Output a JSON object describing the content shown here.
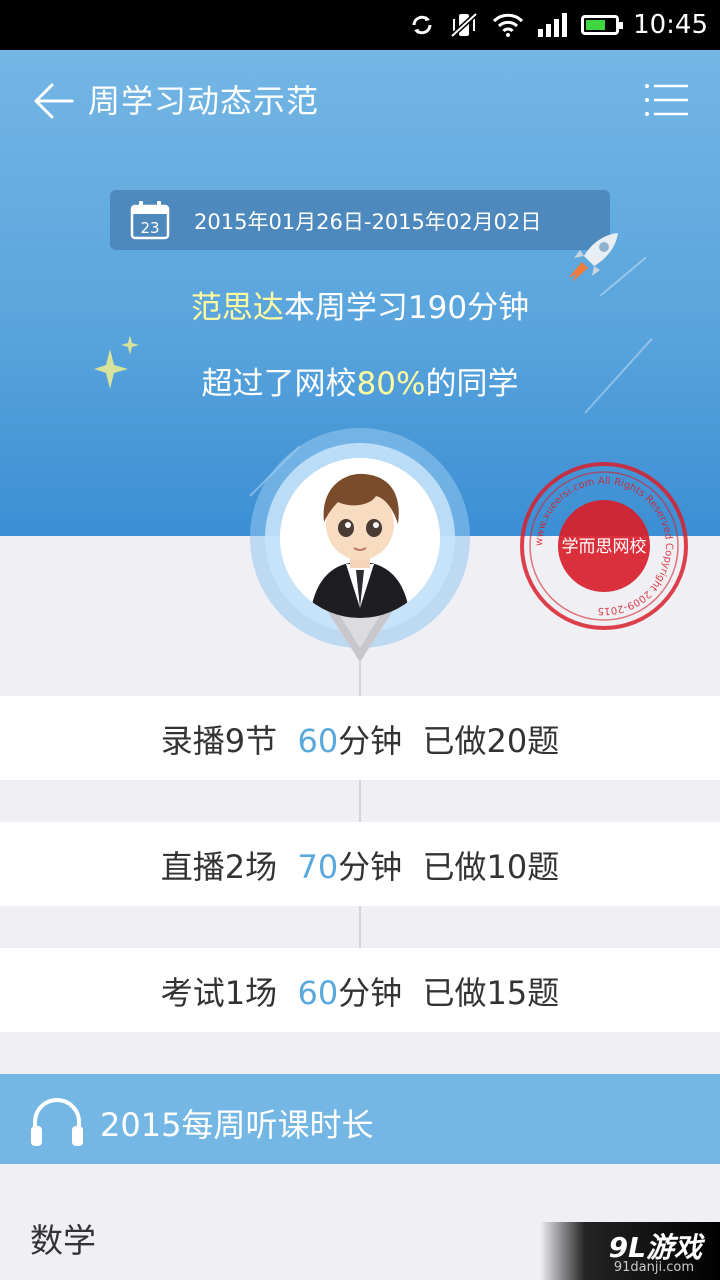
{
  "status_bar": {
    "time": "10:45"
  },
  "nav": {
    "title": "周学习动态示范"
  },
  "date_range": {
    "calendar_day": "23",
    "text": "2015年01月26日-2015年02月02日"
  },
  "summary": {
    "name": "范思达",
    "line1_rest": "本周学习190分钟",
    "line2_prefix": "超过了网校",
    "percent": "80%",
    "line2_suffix": "的同学"
  },
  "stamp": {
    "center_text": "学而思网校",
    "ring_text": "www.xueersi.com All Rights Reserved Copyright 2009-2015"
  },
  "stats": [
    {
      "prefix": "录播9节",
      "value": "60",
      "unit": "分钟",
      "done": "已做20题"
    },
    {
      "prefix": "直播2场",
      "value": "70",
      "unit": "分钟",
      "done": "已做10题"
    },
    {
      "prefix": "考试1场",
      "value": "60",
      "unit": "分钟",
      "done": "已做15题"
    }
  ],
  "section": {
    "title": "2015每周听课时长",
    "icon": "headphones-icon"
  },
  "subject": {
    "label": "数学"
  },
  "watermark": {
    "main": "9L游戏",
    "sub": "91danji.com"
  },
  "colors": {
    "hero_blue": "#5aa5dd",
    "accent_blue": "#5aa8dc",
    "highlight_yellow": "#fffba0",
    "stamp_red": "#d8202a"
  }
}
